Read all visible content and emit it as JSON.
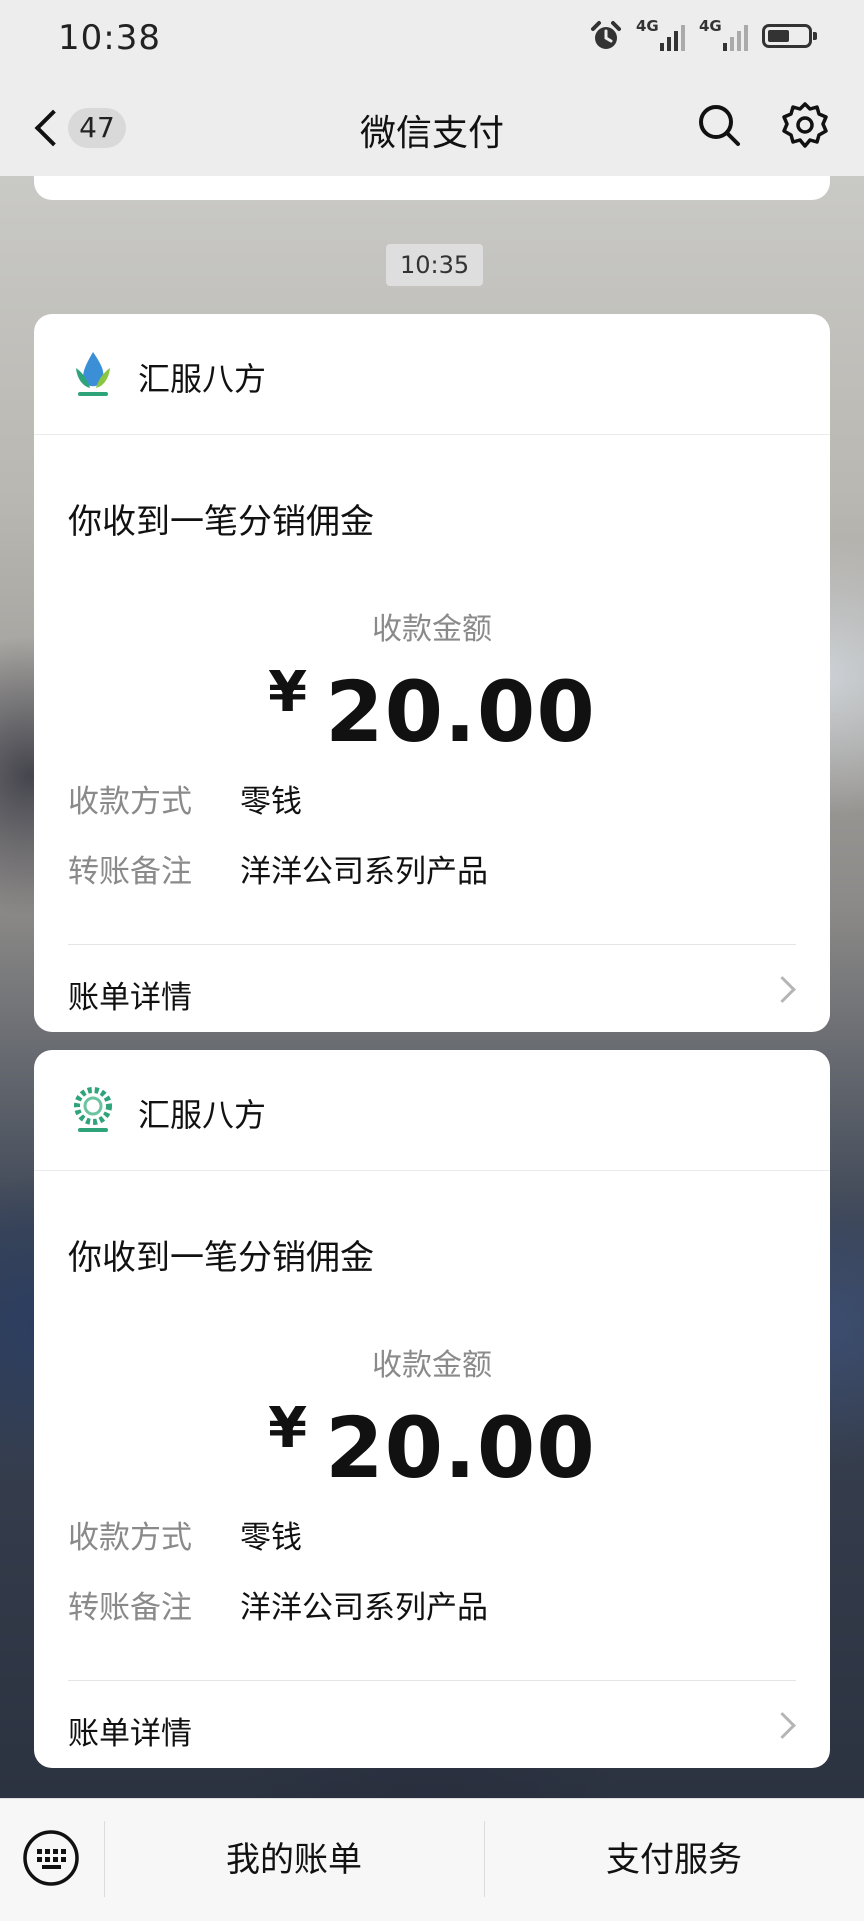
{
  "status_bar": {
    "time": "10:38",
    "network_1": "4G",
    "network_2": "4G",
    "icons": [
      "alarm-icon",
      "signal-icon",
      "signal-icon",
      "battery-icon"
    ],
    "battery_level": 0.55
  },
  "nav": {
    "unread_count": "47",
    "title": "微信支付",
    "icons": [
      "back-chevron-icon",
      "search-icon",
      "gear-icon"
    ]
  },
  "chat": {
    "timestamp": "10:35",
    "messages": [
      {
        "merchant": "汇服八方",
        "title": "你收到一笔分销佣金",
        "amount_label": "收款金额",
        "currency": "¥",
        "amount": "20.00",
        "method_label": "收款方式",
        "method_value": "零钱",
        "note_label": "转账备注",
        "note_value": "洋洋公司系列产品",
        "detail_label": "账单详情"
      },
      {
        "merchant": "汇服八方",
        "title": "你收到一笔分销佣金",
        "amount_label": "收款金额",
        "currency": "¥",
        "amount": "20.00",
        "method_label": "收款方式",
        "method_value": "零钱",
        "note_label": "转账备注",
        "note_value": "洋洋公司系列产品",
        "detail_label": "账单详情"
      }
    ]
  },
  "bottom_menu": {
    "keyboard_icon": "keyboard-icon",
    "items": [
      "我的账单",
      "支付服务"
    ]
  },
  "colors": {
    "bar_background": "#ededed",
    "card_background": "#ffffff",
    "secondary_text": "#8a8a8a",
    "logo_green": "#2fa37a",
    "logo_blue": "#3a8fd6"
  }
}
